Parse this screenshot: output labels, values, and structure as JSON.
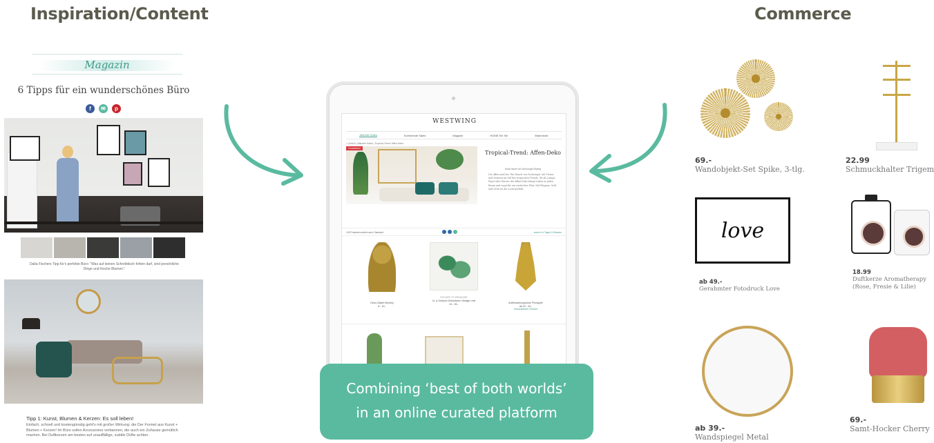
{
  "headings": {
    "left": "Inspiration/Content",
    "right": "Commerce"
  },
  "magazine": {
    "banner": "Magazin",
    "title": "6 Tipps für ein wunderschönes Büro",
    "social_icons": [
      "facebook-icon",
      "mail-icon",
      "pinterest-icon"
    ],
    "caption": "Dalia Fischers Tipp für's perfekte Büro: \"Was auf keinen Schreibtisch fehlen darf, sind persönliche Dinge und frische Blumen.\"",
    "tip_title": "Tipp 1: Kunst, Blumen & Kerzen: Es soll leben!",
    "tip_text": "Einfach, schnell und kostengünstig geht's mit großer Wirkung: die Der Formel aus Kunst + Blumen + Kerzen! Im Büro sollen Accessoires verbannen, die auch ein Zuhause gemütlich machen. Bei Duftkerzen am besten auf unauffällige, subtile Düfte achten."
  },
  "tablet": {
    "brand": "WESTWING",
    "nav": [
      "Aktuelle Sales",
      "Kommende Sales",
      "Magazin",
      "HOME Ein Sie",
      "Warenkorb"
    ],
    "breadcrumb": "< Zurück | Aktuelle Sales | Tropical-Trend: Affen-Deko",
    "hero_tag": "Countdown",
    "hero_title": "Tropical-Trend: Affen-Deko",
    "hero_sub": "Must-haves für Dschungel-Styling",
    "hero_text": "Die Affen sind los! Ein Hauch von Dschungel: mit Tieren und Motiven im Stil des tropischen Trends. Ob als Lampe, Figur oder Kissen: die Affen-Deko bringt Leben in jeden Raum und sorgt für ein exotisches Flair. Mit Eleganz, Gold und Grün ist der Look perfekt.",
    "bar_left": "193 Produkte sortiert nach:   Standard",
    "bar_right": "endet in 4 Tagen 5 Stunden",
    "products": [
      {
        "brand": "",
        "name": "Deko-Objekt Monkey",
        "price": "8.-     15.-"
      },
      {
        "brand": "ESCAPE TO PARADISE",
        "name": "In- & Outdoor-Dekokissen Vintage Leaf",
        "price": "24.-     35.-"
      },
      {
        "brand": "",
        "name": "Aufbewahrungsdose Pineapple",
        "price": "ab 22.-     34.-"
      }
    ],
    "product_extra": "Verschiedene Größen"
  },
  "callout": {
    "line1": "Combining ‘best of both worlds’",
    "line2": "in an online curated platform"
  },
  "commerce": {
    "items": [
      {
        "price": "69.-",
        "name": "Wandobjekt-Set Spike, 3-tlg."
      },
      {
        "price": "22.99",
        "name": "Schmuckhalter Trigem"
      },
      {
        "price": "ab 49.-",
        "name": "Gerahmter Fotodruck Love"
      },
      {
        "price": "18.99",
        "name": "Duftkerze Aromatherapy",
        "name2": "(Rose, Fresie & Lilie)"
      },
      {
        "price": "ab 39.-",
        "name": "Wandspiegel Metal"
      },
      {
        "price": "69.-",
        "name": "Samt-Hocker Cherry"
      }
    ],
    "print_text": "love"
  },
  "colors": {
    "accent": "#5ABA9F",
    "heading": "#5B5B4E",
    "gold": "#C9A458"
  }
}
